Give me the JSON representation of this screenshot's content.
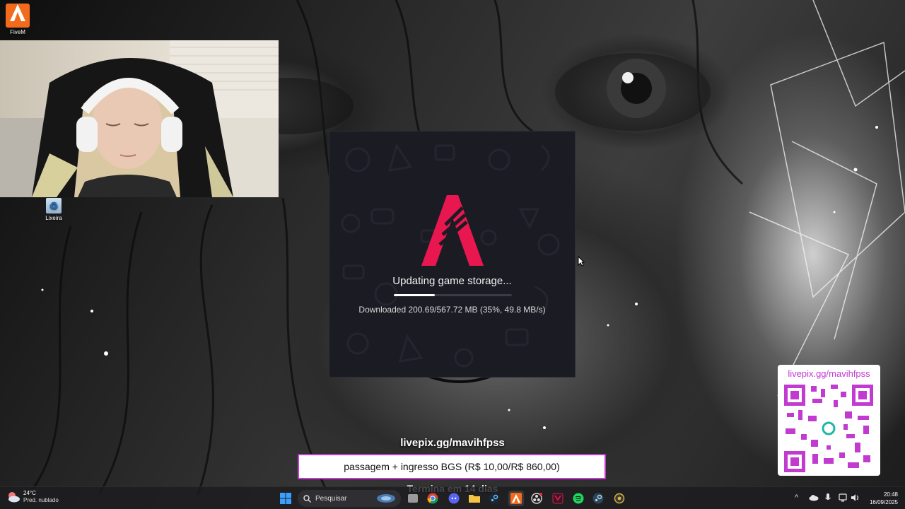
{
  "desktop": {
    "icons": [
      {
        "label": "FiveM"
      },
      {
        "label": "Lixeira"
      }
    ]
  },
  "dialog": {
    "status": "Updating game storage...",
    "progress_fraction": 0.35,
    "detail": "Downloaded 200.69/567.72 MB (35%, 49.8 MB/s)",
    "accent_color": "#e8174f"
  },
  "overlay": {
    "qr_url": "livepix.gg/mavihfpss",
    "goal_url": "livepix.gg/mavihfpss",
    "goal_text": "passagem + ingresso BGS (R$ 10,00/R$ 860,00)",
    "goal_ends": "Termina em 14 dias",
    "accent_color": "#c23bd1"
  },
  "taskbar": {
    "weather_temp": "24°C",
    "weather_desc": "Pred. nublado",
    "search_placeholder": "Pesquisar",
    "apps": [
      "start-icon",
      "search-icon",
      "file-explorer-icon",
      "chrome-icon",
      "discord-icon",
      "folder-icon",
      "steam-icon",
      "fivem-icon",
      "obs-icon",
      "app-icon",
      "spotify-icon",
      "steam-icon",
      "settings-icon"
    ],
    "clock_time": "20:48",
    "clock_date": "16/09/2025"
  }
}
